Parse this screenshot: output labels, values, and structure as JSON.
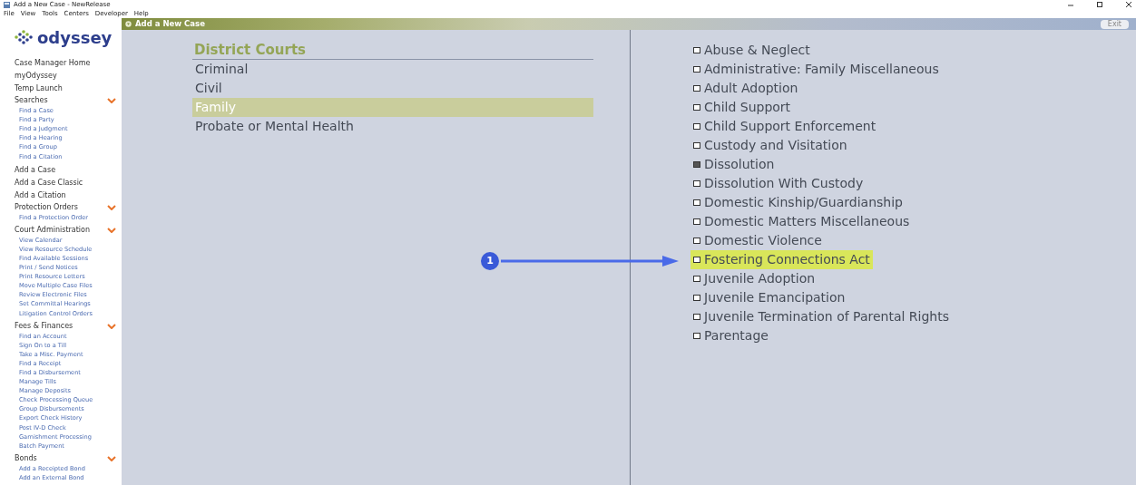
{
  "window": {
    "title": "Add a New Case - NewRelease"
  },
  "menu": [
    "File",
    "View",
    "Tools",
    "Centers",
    "Developer",
    "Help"
  ],
  "logo": "odyssey",
  "sidebar": [
    {
      "kind": "link",
      "label": "Case Manager Home"
    },
    {
      "kind": "link",
      "label": "myOdyssey"
    },
    {
      "kind": "link",
      "label": "Temp Launch"
    },
    {
      "kind": "section",
      "label": "Searches",
      "expanded": true,
      "children": [
        "Find a Case",
        "Find a Party",
        "Find a Judgment",
        "Find a Hearing",
        "Find a Group",
        "Find a Citation"
      ]
    },
    {
      "kind": "link",
      "label": "Add a Case"
    },
    {
      "kind": "link",
      "label": "Add a Case Classic"
    },
    {
      "kind": "link",
      "label": "Add a Citation"
    },
    {
      "kind": "section",
      "label": "Protection Orders",
      "expanded": true,
      "children": [
        "Find a Protection Order"
      ]
    },
    {
      "kind": "section",
      "label": "Court Administration",
      "expanded": true,
      "children": [
        "View Calendar",
        "View Resource Schedule",
        "Find Available Sessions",
        "Print / Send Notices",
        "Print Resource Letters",
        "Move Multiple Case Files",
        "Review Electronic Files",
        "Set Committal Hearings",
        "Litigation Control Orders"
      ]
    },
    {
      "kind": "section",
      "label": "Fees & Finances",
      "expanded": true,
      "children": [
        "Find an Account",
        "Sign On to a Till",
        "Take a Misc. Payment",
        "Find a Receipt",
        "Find a Disbursement",
        "Manage Tills",
        "Manage Deposits",
        "Check Processing Queue",
        "Group Disbursements",
        "Export Check History",
        "Post IV-D Check",
        "Garnishment Processing",
        "Batch Payment"
      ]
    },
    {
      "kind": "section",
      "label": "Bonds",
      "expanded": true,
      "children": [
        "Add a Receipted Bond",
        "Add an External Bond"
      ]
    }
  ],
  "panel": {
    "title": "Add a New Case",
    "exit_button": "Exit"
  },
  "courts": {
    "heading": "District Courts",
    "items": [
      {
        "label": "Criminal",
        "selected": false
      },
      {
        "label": "Civil",
        "selected": false
      },
      {
        "label": "Family",
        "selected": true
      },
      {
        "label": "Probate or Mental Health",
        "selected": false
      }
    ]
  },
  "case_types": [
    {
      "label": "Abuse & Neglect",
      "checked": false,
      "highlighted": false
    },
    {
      "label": "Administrative: Family Miscellaneous",
      "checked": false,
      "highlighted": false
    },
    {
      "label": "Adult Adoption",
      "checked": false,
      "highlighted": false
    },
    {
      "label": "Child Support",
      "checked": false,
      "highlighted": false
    },
    {
      "label": "Child Support Enforcement",
      "checked": false,
      "highlighted": false
    },
    {
      "label": "Custody and Visitation",
      "checked": false,
      "highlighted": false
    },
    {
      "label": "Dissolution",
      "checked": true,
      "highlighted": false
    },
    {
      "label": "Dissolution With Custody",
      "checked": false,
      "highlighted": false
    },
    {
      "label": "Domestic Kinship/Guardianship",
      "checked": false,
      "highlighted": false
    },
    {
      "label": "Domestic Matters Miscellaneous",
      "checked": false,
      "highlighted": false
    },
    {
      "label": "Domestic Violence",
      "checked": false,
      "highlighted": false
    },
    {
      "label": "Fostering Connections Act",
      "checked": false,
      "highlighted": true
    },
    {
      "label": "Juvenile Adoption",
      "checked": false,
      "highlighted": false
    },
    {
      "label": "Juvenile Emancipation",
      "checked": false,
      "highlighted": false
    },
    {
      "label": "Juvenile Termination of Parental Rights",
      "checked": false,
      "highlighted": false
    },
    {
      "label": "Parentage",
      "checked": false,
      "highlighted": false
    }
  ],
  "callout": {
    "number": "1"
  }
}
